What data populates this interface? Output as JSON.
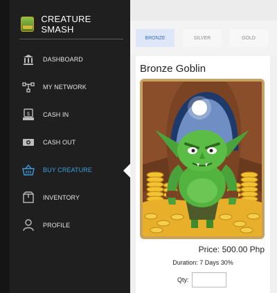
{
  "app": {
    "name": "CREATURE SMASH",
    "logo_text": "SMASH"
  },
  "sidebar": {
    "items": [
      {
        "label": "DASHBOARD",
        "icon": "bank-icon",
        "active": false
      },
      {
        "label": "MY NETWORK",
        "icon": "network-icon",
        "active": false
      },
      {
        "label": "CASH IN",
        "icon": "cash-in-icon",
        "active": false
      },
      {
        "label": "CASH OUT",
        "icon": "cash-out-icon",
        "active": false
      },
      {
        "label": "BUY CREATURE",
        "icon": "basket-icon",
        "active": true
      },
      {
        "label": "INVENTORY",
        "icon": "box-icon",
        "active": false
      },
      {
        "label": "PROFILE",
        "icon": "user-icon",
        "active": false
      }
    ]
  },
  "tabs": [
    {
      "label": "BRONZE",
      "active": true
    },
    {
      "label": "SILVER",
      "active": false
    },
    {
      "label": "GOLD",
      "active": false
    }
  ],
  "card": {
    "title": "Bronze Goblin",
    "price": "Price: 500.00 Php",
    "duration": "Duration: 7 Days 30%",
    "qty_label": "Qty:",
    "qty_value": ""
  },
  "colors": {
    "sidebar_bg": "#1f1f1f",
    "active_text": "#3b9fe0",
    "active_tab_bg": "#dde7f7",
    "active_tab_text": "#3a6cc8"
  }
}
